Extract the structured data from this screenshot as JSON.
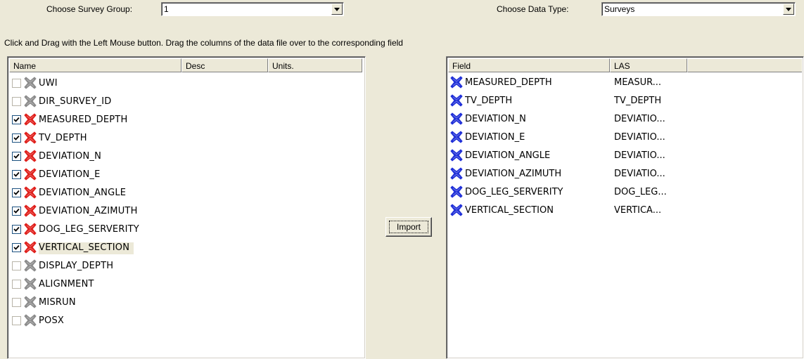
{
  "survey_group": {
    "label": "Choose Survey Group:",
    "value": "1"
  },
  "data_type": {
    "label": "Choose Data Type:",
    "value": "Surveys"
  },
  "instructions": "Click and Drag with the Left Mouse button. Drag the columns of the data file over to the corresponding field",
  "left_list": {
    "columns": [
      "Name",
      "Desc",
      "Units."
    ],
    "rows": [
      {
        "name": "UWI",
        "checked": false,
        "icon": "gray-cross-icon"
      },
      {
        "name": "DIR_SURVEY_ID",
        "checked": false,
        "icon": "gray-cross-icon"
      },
      {
        "name": "MEASURED_DEPTH",
        "checked": true,
        "icon": "red-cross-icon"
      },
      {
        "name": "TV_DEPTH",
        "checked": true,
        "icon": "red-cross-icon"
      },
      {
        "name": "DEVIATION_N",
        "checked": true,
        "icon": "red-cross-icon"
      },
      {
        "name": "DEVIATION_E",
        "checked": true,
        "icon": "red-cross-icon"
      },
      {
        "name": "DEVIATION_ANGLE",
        "checked": true,
        "icon": "red-cross-icon"
      },
      {
        "name": "DEVIATION_AZIMUTH",
        "checked": true,
        "icon": "red-cross-icon"
      },
      {
        "name": "DOG_LEG_SERVERITY",
        "checked": true,
        "icon": "red-cross-icon"
      },
      {
        "name": "VERTICAL_SECTION",
        "checked": true,
        "icon": "red-cross-icon",
        "selected": true
      },
      {
        "name": "DISPLAY_DEPTH",
        "checked": false,
        "icon": "gray-cross-icon"
      },
      {
        "name": "ALIGNMENT",
        "checked": false,
        "icon": "gray-cross-icon"
      },
      {
        "name": "MISRUN",
        "checked": false,
        "icon": "gray-cross-icon"
      },
      {
        "name": "POSX",
        "checked": false,
        "icon": "gray-cross-icon"
      }
    ]
  },
  "import_button": {
    "label": "Import"
  },
  "right_list": {
    "columns": [
      "Field",
      "LAS"
    ],
    "rows": [
      {
        "field": "MEASURED_DEPTH",
        "las": "MEASUR...",
        "icon": "blue-cross-icon"
      },
      {
        "field": "TV_DEPTH",
        "las": "TV_DEPTH",
        "icon": "blue-cross-icon"
      },
      {
        "field": "DEVIATION_N",
        "las": "DEVIATIO...",
        "icon": "blue-cross-icon"
      },
      {
        "field": "DEVIATION_E",
        "las": "DEVIATIO...",
        "icon": "blue-cross-icon"
      },
      {
        "field": "DEVIATION_ANGLE",
        "las": "DEVIATIO...",
        "icon": "blue-cross-icon"
      },
      {
        "field": "DEVIATION_AZIMUTH",
        "las": "DEVIATIO...",
        "icon": "blue-cross-icon"
      },
      {
        "field": "DOG_LEG_SERVERITY",
        "las": "DOG_LEG...",
        "icon": "blue-cross-icon"
      },
      {
        "field": "VERTICAL_SECTION",
        "las": "VERTICA...",
        "icon": "blue-cross-icon"
      }
    ]
  },
  "colors": {
    "red_icon": "#e0201c",
    "gray_icon": "#8c8c8c",
    "blue_icon": "#2030d8",
    "selected_row": "#ECE9D8"
  }
}
